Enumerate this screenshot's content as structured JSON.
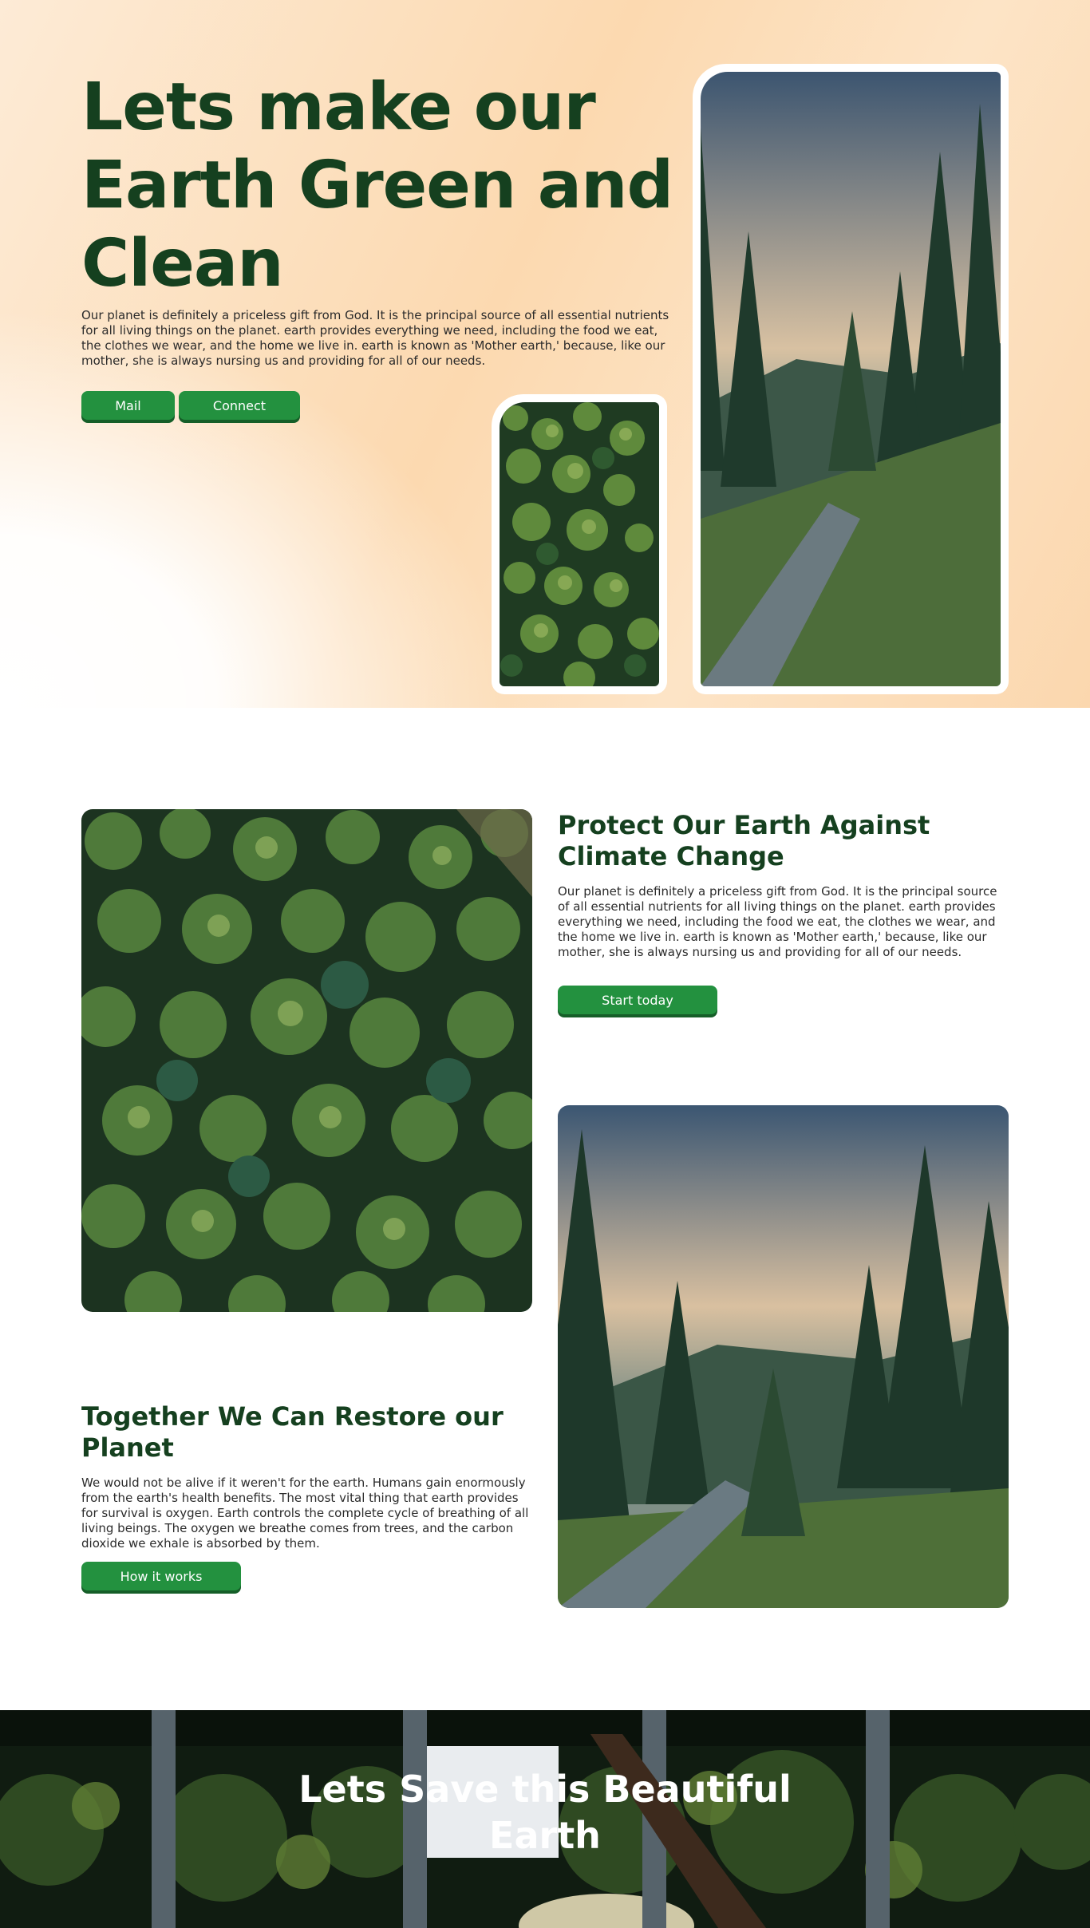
{
  "hero": {
    "title": "Lets make our Earth Green and Clean",
    "description": "Our planet is definitely a priceless gift from God. It is the principal source of all essential nutrients for all living things on the planet. earth provides everything we need, including the food we eat, the clothes we wear, and the home we live in. earth is known as 'Mother earth,' because, like our mother, she is always nursing us and providing for all of our needs.",
    "buttons": {
      "mail": "Mail",
      "connect": "Connect"
    }
  },
  "features": [
    {
      "title": "Protect Our Earth Against Climate Change",
      "text": "Our planet is definitely a priceless gift from God. It is the principal source of all essential nutrients for all living things on the planet. earth provides everything we need, including the food we eat, the clothes we wear, and the home we live in. earth is known as 'Mother earth,' because, like our mother, she is always nursing us and providing for all of our needs.",
      "button": "Start today"
    },
    {
      "title": "Together We Can Restore our Planet",
      "text": "We would not be alive if it weren't for the earth. Humans gain enormously from the earth's health benefits. The most vital thing that earth provides for survival is oxygen. Earth controls the complete cycle of breathing of all living beings. The oxygen we breathe comes from trees, and the carbon dioxide we exhale is absorbed by them.",
      "button": "How it works"
    }
  ],
  "banner": {
    "title": "Lets Save this Beautiful Earth"
  },
  "colors": {
    "heading": "#15401f",
    "button": "#23913f",
    "button_shadow": "#155e28",
    "hero_bg": "#fcd9b0"
  }
}
